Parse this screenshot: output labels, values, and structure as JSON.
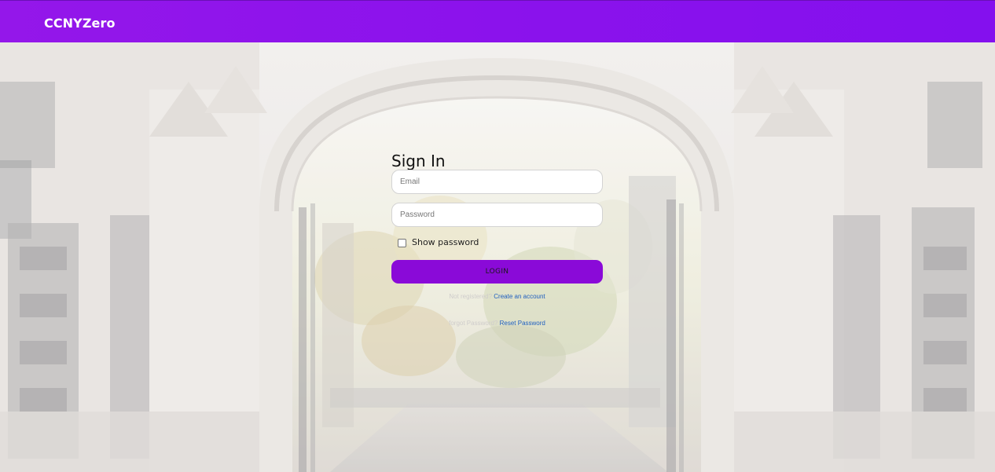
{
  "navbar": {
    "brand": "CCNYZero"
  },
  "signin": {
    "title": "Sign In",
    "email": {
      "placeholder": "Email",
      "value": ""
    },
    "password": {
      "placeholder": "Password",
      "value": ""
    },
    "show_password": {
      "label": "Show password",
      "checked": false
    },
    "login_button": "LOGIN",
    "register": {
      "prompt": "Not registered?",
      "link": "Create an account"
    },
    "forgot": {
      "prompt": "forgot Password?",
      "link": "Reset Password"
    }
  },
  "colors": {
    "navbar": "#8b12ec",
    "login_button": "#8a0ad8",
    "link": "#1f5fbf"
  },
  "background_image": "campus-stone-gate-arch"
}
